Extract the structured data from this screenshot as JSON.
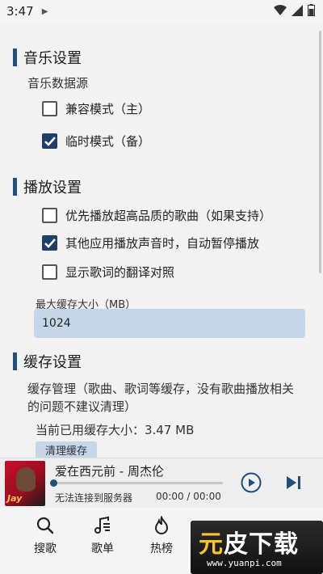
{
  "status_bar": {
    "time": "3:47"
  },
  "sections": {
    "music": {
      "title": "音乐设置",
      "source_label": "音乐数据源",
      "options": [
        {
          "label": "兼容模式（主）",
          "checked": false
        },
        {
          "label": "临时模式（备）",
          "checked": true
        }
      ]
    },
    "playback": {
      "title": "播放设置",
      "options": [
        {
          "label": "优先播放超高品质的歌曲（如果支持）",
          "checked": false
        },
        {
          "label": "其他应用播放声音时，自动暂停播放",
          "checked": true
        },
        {
          "label": "显示歌词的翻译对照",
          "checked": false
        }
      ],
      "cache_field_label": "最大缓存大小（MB）",
      "cache_field_value": "1024"
    },
    "cache": {
      "title": "缓存设置",
      "description_line1": "缓存管理（歌曲、歌词等缓存，没有歌曲播放相关",
      "description_line2": "的问题不建议清理）",
      "current_size": "当前已用缓存大小：3.47 MB",
      "clear_button": "清理缓存"
    }
  },
  "player": {
    "song_title": "爱在西元前 - 周杰伦",
    "status": "无法连接到服务器",
    "time": "00:00 / 00:00",
    "progress": 0,
    "album_text": "Jay"
  },
  "nav": {
    "items": [
      {
        "label": "搜歌",
        "icon": "search-icon"
      },
      {
        "label": "歌单",
        "icon": "music-list-icon"
      },
      {
        "label": "热榜",
        "icon": "flame-icon"
      }
    ]
  },
  "watermark": {
    "text_a": "元",
    "text_b": "皮下载",
    "url": "www.yuanpi.com"
  },
  "colors": {
    "accent": "#1f4f7b",
    "checked": "#1f3f67",
    "field": "#c5d6e9"
  }
}
